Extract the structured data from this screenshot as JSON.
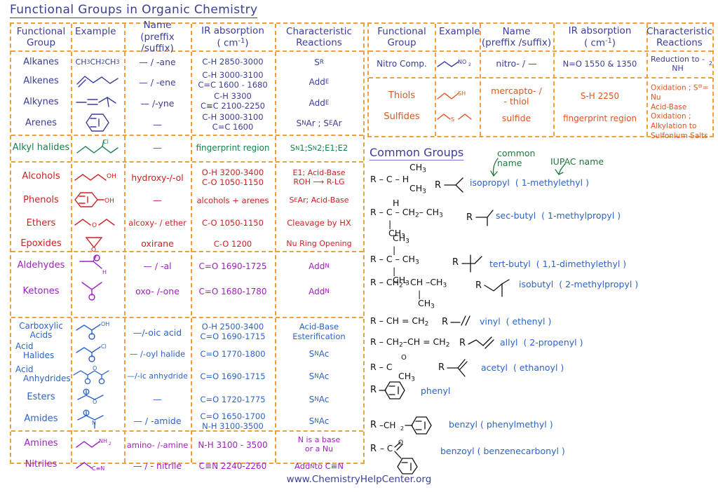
{
  "page": {
    "title": "Functional Groups in Organic Chemistry",
    "footer": "www.ChemistryHelpCenter.org"
  },
  "colors": {
    "ink": "#3b3e96",
    "border": "#f2a03c",
    "green": "#17804c",
    "red": "#cc2222",
    "purple": "#a020c0",
    "blue": "#2d63c8",
    "orange": "#e0551f",
    "note_green": "#1b7a3a"
  },
  "table_headers": {
    "col1_line1": "Functional",
    "col1_line2": "Group",
    "col2": "Example",
    "col3_line1": "Name",
    "col3_line2": "(preffix /suffix)",
    "col4_line1": "IR absorption",
    "col4_line2": "( cm",
    "col4_exp": "-1",
    "col4_end": ")",
    "col5_line1": "Characteristic",
    "col5_line2": "Reactions"
  },
  "left_table": {
    "groups": [
      {
        "color_key": "ink",
        "rows": [
          {
            "group": "Alkanes",
            "name": "— / -ane",
            "ir": "C-H  2850-3000",
            "rx": "S R"
          },
          {
            "group": "Alkenes",
            "name": "— / -ene",
            "ir": "C-H   3000-3100\nC=C   1600 - 1680",
            "rx": "Add E"
          },
          {
            "group": "Alkynes",
            "name": "— /-yne",
            "ir": "C-H   3300\nC≡C  2100-2250",
            "rx": "Add E"
          },
          {
            "group": "Arenes",
            "name": "—",
            "ir": "C-H   3000-3100\nC=C   1600",
            "rx": "S N Ar ; S E Ar"
          }
        ]
      },
      {
        "color_key": "green",
        "rows": [
          {
            "group": "Alkyl halides",
            "name": "—",
            "ir": "fingerprint region",
            "rx": "S N 1; S N 2; E1; E2"
          }
        ]
      },
      {
        "color_key": "red",
        "rows": [
          {
            "group": "Alcohols",
            "name": "hydroxy-/-ol",
            "ir": "O-H  3200-3400\nC-O  1050-1150",
            "rx": "E1; Acid-Base\nROH ⟶ R-LG"
          },
          {
            "group": "Phenols",
            "name": "—",
            "ir": "alcohols + arenes",
            "rx": "S E Ar; Acid-Base"
          },
          {
            "group": "Ethers",
            "name": "alcoxy- / ether",
            "ir": "C-O  1050-1150",
            "rx": "Cleavage by HX"
          },
          {
            "group": "Epoxides",
            "name": "oxirane",
            "ir": "C-O   1200",
            "rx": "Nu Ring Opening"
          }
        ]
      },
      {
        "color_key": "purple",
        "rows": [
          {
            "group": "Aldehydes",
            "name": "— / -al",
            "ir": "C=O  1690-1725",
            "rx": "Add N"
          },
          {
            "group": "Ketones",
            "name": "oxo- /-one",
            "ir": "C=O  1680-1780",
            "rx": "Add N"
          }
        ]
      },
      {
        "color_key": "blue",
        "rows": [
          {
            "group": "Carboxylic\nAcids",
            "name": "—/-oic acid",
            "ir": "O-H  2500-3400\nC=O  1690-1715",
            "rx": "Acid-Base\nEsterification"
          },
          {
            "group": "Acid\n   Halides",
            "name": "— /-oyl halide",
            "ir": "C=O  1770-1800",
            "rx": "S N Ac"
          },
          {
            "group": "Acid\n   Anhydrides",
            "name": "—/-ic anhydride",
            "ir": "C=O  1690-1715",
            "rx": "S N Ac"
          },
          {
            "group": "Esters",
            "name": "—",
            "ir": "C=O  1720-1775",
            "rx": "S N Ac"
          },
          {
            "group": "Amides",
            "name": "— / -amide",
            "ir": "C=O  1650-1700\nN-H  3100-3500",
            "rx": "S N Ac"
          }
        ]
      },
      {
        "color_key": "purple2",
        "rows": [
          {
            "group": "Amines",
            "name": "amino- /-amine",
            "ir": "N-H  3100 - 3500",
            "rx": "N is a base\nor a Nu"
          },
          {
            "group": "Nitriles",
            "name": "— / - nitrile",
            "ir": "C≡N  2240-2260",
            "rx": "Add N to C≡N"
          }
        ]
      }
    ]
  },
  "right_table": {
    "groups": [
      {
        "color_key": "ink",
        "rows": [
          {
            "group": "Nitro Comp.",
            "name": "nitro- / —",
            "ir": "N=O  1550 & 1350",
            "rx": "Reduction to -NH2"
          }
        ]
      },
      {
        "color_key": "orange",
        "rows": [
          {
            "group": "Thiols",
            "name": "mercapto- /\n- thiol",
            "ir": "S-H   2250",
            "rx": "Oxidation ; S = Nu\nAcid-Base"
          },
          {
            "group": "Sulfides",
            "name": "sulfide",
            "ir": "fingerprint region",
            "rx": "Oxidation ;\nAlkylation to\nSulfonium Salts"
          }
        ]
      }
    ]
  },
  "common_groups": {
    "heading": "Common Groups",
    "note_common": "common\nname",
    "note_iupac": "IUPAC name",
    "entries": [
      {
        "formula_html": "common-1",
        "common": "isopropyl",
        "iupac": "( 1-methylethyl )"
      },
      {
        "formula_html": "common-2",
        "common": "sec-butyl",
        "iupac": "( 1-methylpropyl )"
      },
      {
        "formula_html": "common-3",
        "common": "tert-butyl",
        "iupac": "( 1,1-dimethylethyl )"
      },
      {
        "formula_html": "common-4",
        "common": "isobutyl",
        "iupac": "( 2-methylpropyl )"
      },
      {
        "formula_html": "common-5",
        "common": "vinyl",
        "iupac": "( ethenyl )"
      },
      {
        "formula_html": "common-6",
        "common": "allyl",
        "iupac": "( 2-propenyl )"
      },
      {
        "formula_html": "common-7",
        "common": "acetyl",
        "iupac": "( ethanoyl )"
      },
      {
        "formula_html": "common-8",
        "common": "phenyl",
        "iupac": ""
      },
      {
        "formula_html": "common-9",
        "common": "benzyl",
        "iupac": "( phenylmethyl )"
      },
      {
        "formula_html": "common-10",
        "common": "benzoyl",
        "iupac": "( benzenecarbonyl )"
      }
    ]
  }
}
